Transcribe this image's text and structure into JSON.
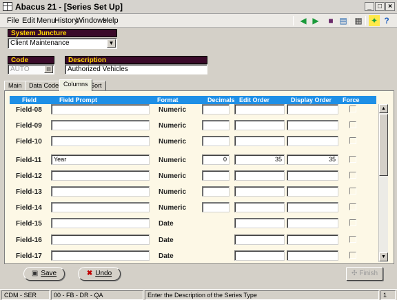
{
  "window": {
    "title": "Abacus 21 - [Series Set Up]",
    "min": "_",
    "max": "□",
    "close": "×"
  },
  "menu": [
    "File",
    "Edit",
    "Menu",
    "History",
    "Windows",
    "Help"
  ],
  "toolbar_icons": [
    "green-arrow-left-icon",
    "green-arrow-right-icon",
    "book-icon",
    "record-icon",
    "calculator-icon",
    "runner-icon",
    "help-icon"
  ],
  "system_juncture": {
    "label": "System Juncture",
    "value": "Client Maintenance"
  },
  "code": {
    "label": "Code",
    "value": "AUTO"
  },
  "description": {
    "label": "Description",
    "value": "Authorized Vehicles"
  },
  "tabs": [
    "Main",
    "Data Codes",
    "Columns",
    "Sort"
  ],
  "active_tab": "Columns",
  "grid": {
    "headers": [
      "Field",
      "Field Prompt",
      "Format",
      "Decimals",
      "Edit Order",
      "Display Order",
      "Force"
    ],
    "rows": [
      {
        "field": "Field-08",
        "prompt": "",
        "format": "Numeric",
        "decimals": "",
        "edit_order": "",
        "display_order": ""
      },
      {
        "field": "Field-09",
        "prompt": "",
        "format": "Numeric",
        "decimals": "",
        "edit_order": "",
        "display_order": ""
      },
      {
        "field": "Field-10",
        "prompt": "",
        "format": "Numeric",
        "decimals": "",
        "edit_order": "",
        "display_order": ""
      },
      {
        "field": "Field-11",
        "prompt": "Year",
        "format": "Numeric",
        "decimals": "0",
        "edit_order": "35",
        "display_order": "35"
      },
      {
        "field": "Field-12",
        "prompt": "",
        "format": "Numeric",
        "decimals": "",
        "edit_order": "",
        "display_order": ""
      },
      {
        "field": "Field-13",
        "prompt": "",
        "format": "Numeric",
        "decimals": "",
        "edit_order": "",
        "display_order": ""
      },
      {
        "field": "Field-14",
        "prompt": "",
        "format": "Numeric",
        "decimals": "",
        "edit_order": "",
        "display_order": ""
      },
      {
        "field": "Field-15",
        "prompt": "",
        "format": "Date",
        "decimals": null,
        "edit_order": "",
        "display_order": ""
      },
      {
        "field": "Field-16",
        "prompt": "",
        "format": "Date",
        "decimals": null,
        "edit_order": "",
        "display_order": ""
      },
      {
        "field": "Field-17",
        "prompt": "",
        "format": "Date",
        "decimals": null,
        "edit_order": "",
        "display_order": ""
      }
    ]
  },
  "buttons": {
    "save": "Save",
    "undo": "Undo",
    "finish": "Finish"
  },
  "status": {
    "company": "CDM - SER",
    "path": "00 - FB - DR - QA",
    "message": "Enter the Description of the Series Type",
    "page": "1"
  },
  "colors": {
    "header_blue": "#1e8fe6",
    "label_maroon": "#3a0a2a",
    "label_yellow": "#ffd400",
    "panel_bg": "#fdf8e6"
  }
}
